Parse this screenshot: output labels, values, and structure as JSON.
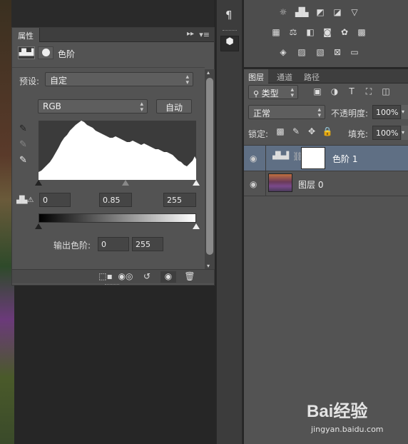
{
  "properties_panel": {
    "tab_label": "属性",
    "header_label": "色阶",
    "preset_label": "预设:",
    "preset_value": "自定",
    "channel_value": "RGB",
    "auto_button": "自动",
    "input_levels": {
      "black": "0",
      "gamma": "0.85",
      "white": "255"
    },
    "output_label": "输出色阶:",
    "output_levels": {
      "black": "0",
      "white": "255"
    }
  },
  "layers_panel": {
    "tabs": [
      "图层",
      "通道",
      "路径"
    ],
    "filter_kind": "类型",
    "blend_mode": "正常",
    "opacity_label": "不透明度:",
    "opacity_value": "100%",
    "lock_label": "锁定:",
    "fill_label": "填充:",
    "fill_value": "100%",
    "layers": [
      {
        "name": "色阶 1",
        "type": "adjustment",
        "selected": true
      },
      {
        "name": "图层 0",
        "type": "image",
        "selected": false
      }
    ]
  },
  "watermark": {
    "brand_line": "Bai经验",
    "url": "jingyan.baidu.com"
  },
  "colors": {
    "panel_bg": "#535353",
    "selected_layer": "#5f6f84",
    "dark_bg": "#262626"
  }
}
